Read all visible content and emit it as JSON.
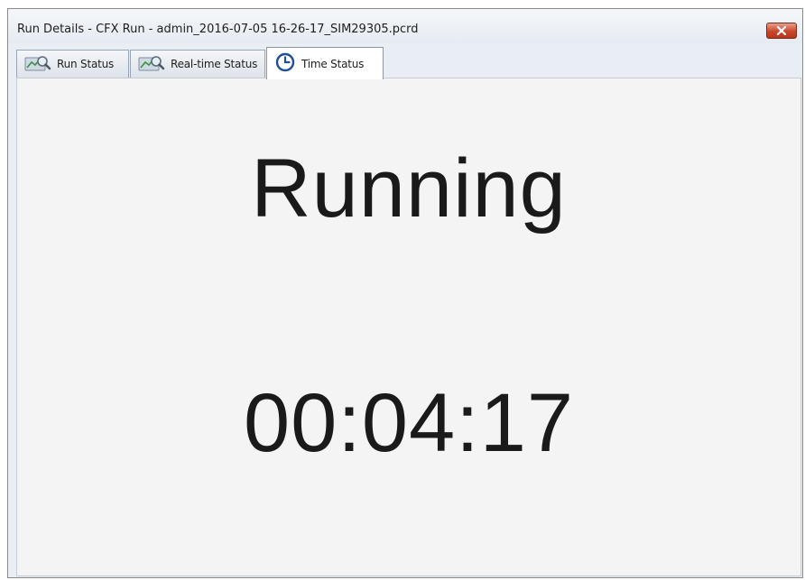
{
  "window": {
    "title": "Run Details - CFX Run - admin_2016-07-05 16-26-17_SIM29305.pcrd",
    "close_icon": "close-icon"
  },
  "tabs": [
    {
      "label": "Run Status",
      "icon": "chart-magnifier-icon",
      "active": false
    },
    {
      "label": "Real-time Status",
      "icon": "chart-magnifier-icon",
      "active": false
    },
    {
      "label": "Time Status",
      "icon": "clock-icon",
      "active": true
    }
  ],
  "time_status": {
    "state": "Running",
    "elapsed": "00:04:17"
  },
  "colors": {
    "close_button": "#c9462b",
    "content_bg": "#f4f4f4",
    "text": "#1a1a1a",
    "clock_icon": "#1f4e9a"
  }
}
